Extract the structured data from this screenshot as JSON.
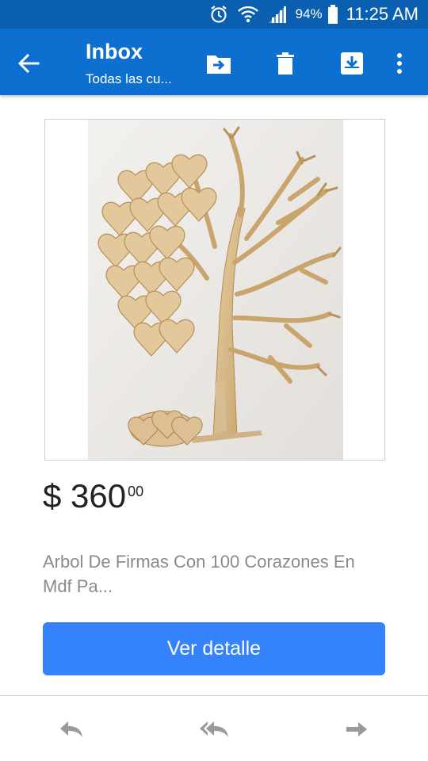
{
  "status_bar": {
    "battery_percent": "94%",
    "time": "11:25 AM",
    "icons": [
      "alarm-icon",
      "wifi-icon",
      "signal-icon",
      "battery-icon"
    ]
  },
  "app_bar": {
    "title": "Inbox",
    "subtitle": "Todas las cu...",
    "actions": [
      "move-to-folder-icon",
      "delete-icon",
      "archive-download-icon",
      "more-options-icon"
    ],
    "color": "#0d6fcf"
  },
  "product": {
    "price_main": "$ 360",
    "price_cents": "00",
    "description": "Arbol De Firmas Con 100 Corazones En Mdf Pa...",
    "detail_button_label": "Ver detalle",
    "button_color": "#3483fa"
  },
  "bottom_nav": {
    "icons": [
      "reply-icon",
      "reply-all-icon",
      "forward-icon"
    ]
  }
}
